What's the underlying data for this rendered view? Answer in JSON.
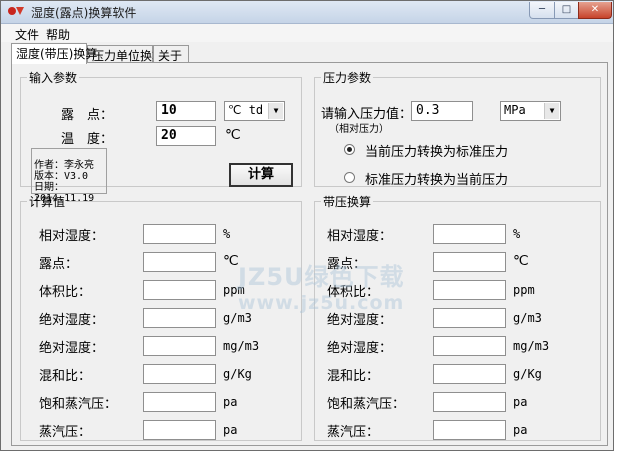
{
  "window": {
    "title": "湿度(露点)换算软件",
    "controls": {
      "minimize": "─",
      "maximize": "□",
      "close": "✕"
    }
  },
  "menu": {
    "file": "文件",
    "help": "帮助"
  },
  "tabs": [
    {
      "label": "湿度(带压)换算",
      "active": true
    },
    {
      "label": "压力单位换算",
      "active": false
    },
    {
      "label": "关于",
      "active": false
    }
  ],
  "input_params": {
    "legend": "输入参数",
    "dewpoint_label": "露　点：",
    "dewpoint_value": "10",
    "dewpoint_unit": "℃ td",
    "temperature_label": "温　度：",
    "temperature_value": "20",
    "temperature_unit": "℃",
    "author_lines": [
      "作者：李永亮",
      "版本：V3.0",
      "日期：2014.11.19"
    ],
    "calc_button": "计算"
  },
  "pressure_params": {
    "legend": "压力参数",
    "prompt": "请输入压力值：",
    "sub_prompt": "（相对压力）",
    "value": "0.3",
    "unit": "MPa",
    "radio_options": [
      {
        "label": "当前压力转换为标准压力",
        "checked": true
      },
      {
        "label": "标准压力转换为当前压力",
        "checked": false
      }
    ]
  },
  "calc_values": {
    "legend": "计算值",
    "rows": [
      {
        "label": "相对湿度：",
        "unit": "%"
      },
      {
        "label": "露点：",
        "unit": "℃"
      },
      {
        "label": "体积比：",
        "unit": "ppm"
      },
      {
        "label": "绝对湿度：",
        "unit": "g/m3"
      },
      {
        "label": "绝对湿度：",
        "unit": "mg/m3"
      },
      {
        "label": "混和比：",
        "unit": "g/Kg"
      },
      {
        "label": "饱和蒸汽压：",
        "unit": "pa"
      },
      {
        "label": "蒸汽压：",
        "unit": "pa"
      }
    ]
  },
  "pressure_calc": {
    "legend": "带压换算",
    "rows": [
      {
        "label": "相对湿度：",
        "unit": "%"
      },
      {
        "label": "露点：",
        "unit": "℃"
      },
      {
        "label": "体积比：",
        "unit": "ppm"
      },
      {
        "label": "绝对湿度：",
        "unit": "g/m3"
      },
      {
        "label": "绝对湿度：",
        "unit": "mg/m3"
      },
      {
        "label": "混和比：",
        "unit": "g/Kg"
      },
      {
        "label": "饱和蒸汽压：",
        "unit": "pa"
      },
      {
        "label": "蒸汽压：",
        "unit": "pa"
      }
    ]
  },
  "watermark": {
    "line1": "JZ5U绿色下载",
    "line2": "www.jz5u.com"
  }
}
